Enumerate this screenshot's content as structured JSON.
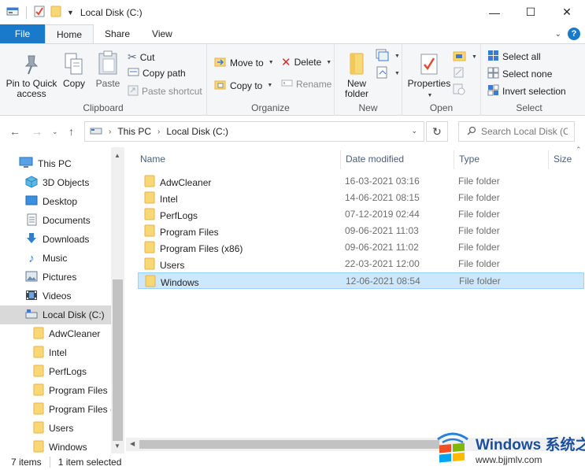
{
  "window": {
    "title": "Local Disk (C:)",
    "minimize_glyph": "—",
    "maximize_glyph": "☐",
    "close_glyph": "✕"
  },
  "tabs": {
    "file": "File",
    "home": "Home",
    "share": "Share",
    "view": "View",
    "help_glyph": "?"
  },
  "ribbon": {
    "clipboard": {
      "label": "Clipboard",
      "pin_to_quick_access": "Pin to Quick access",
      "copy": "Copy",
      "paste": "Paste",
      "cut": "Cut",
      "copy_path": "Copy path",
      "paste_shortcut": "Paste shortcut"
    },
    "organize": {
      "label": "Organize",
      "move_to": "Move to",
      "copy_to": "Copy to",
      "delete": "Delete",
      "rename": "Rename"
    },
    "new": {
      "label": "New",
      "new_folder": "New folder"
    },
    "open": {
      "label": "Open",
      "properties": "Properties"
    },
    "select": {
      "label": "Select",
      "select_all": "Select all",
      "select_none": "Select none",
      "invert_selection": "Invert selection"
    }
  },
  "address_bar": {
    "breadcrumbs": [
      "This PC",
      "Local Disk (C:)"
    ],
    "search_placeholder": "Search Local Disk (C:)"
  },
  "sidebar": {
    "items": [
      {
        "label": "This PC",
        "icon": "computer-icon"
      },
      {
        "label": "3D Objects",
        "icon": "cube-icon"
      },
      {
        "label": "Desktop",
        "icon": "desktop-icon"
      },
      {
        "label": "Documents",
        "icon": "documents-icon"
      },
      {
        "label": "Downloads",
        "icon": "download-arrow-icon"
      },
      {
        "label": "Music",
        "icon": "music-note-icon"
      },
      {
        "label": "Pictures",
        "icon": "pictures-icon"
      },
      {
        "label": "Videos",
        "icon": "video-icon"
      },
      {
        "label": "Local Disk (C:)",
        "icon": "drive-icon",
        "selected": true
      },
      {
        "label": "AdwCleaner",
        "icon": "folder-icon"
      },
      {
        "label": "Intel",
        "icon": "folder-icon"
      },
      {
        "label": "PerfLogs",
        "icon": "folder-icon"
      },
      {
        "label": "Program Files",
        "icon": "folder-icon"
      },
      {
        "label": "Program Files (",
        "icon": "folder-icon"
      },
      {
        "label": "Users",
        "icon": "folder-icon"
      },
      {
        "label": "Windows",
        "icon": "folder-icon"
      }
    ]
  },
  "file_list": {
    "columns": {
      "name": "Name",
      "date_modified": "Date modified",
      "type": "Type",
      "size": "Size"
    },
    "rows": [
      {
        "name": "AdwCleaner",
        "date": "16-03-2021 03:16",
        "type": "File folder"
      },
      {
        "name": "Intel",
        "date": "14-06-2021 08:15",
        "type": "File folder"
      },
      {
        "name": "PerfLogs",
        "date": "07-12-2019 02:44",
        "type": "File folder"
      },
      {
        "name": "Program Files",
        "date": "09-06-2021 11:03",
        "type": "File folder"
      },
      {
        "name": "Program Files (x86)",
        "date": "09-06-2021 11:02",
        "type": "File folder"
      },
      {
        "name": "Users",
        "date": "22-03-2021 12:00",
        "type": "File folder"
      },
      {
        "name": "Windows",
        "date": "12-06-2021 08:54",
        "type": "File folder",
        "selected": true
      }
    ]
  },
  "status_bar": {
    "item_count": "7 items",
    "selection": "1 item selected"
  },
  "watermark": {
    "title": "Windows 系统之家",
    "url": "www.bjjmlv.com"
  },
  "colors": {
    "accent": "#1979ca",
    "folder": "#f8d775",
    "selection_bg": "#cce8ff",
    "selection_border": "#99d1ff"
  }
}
